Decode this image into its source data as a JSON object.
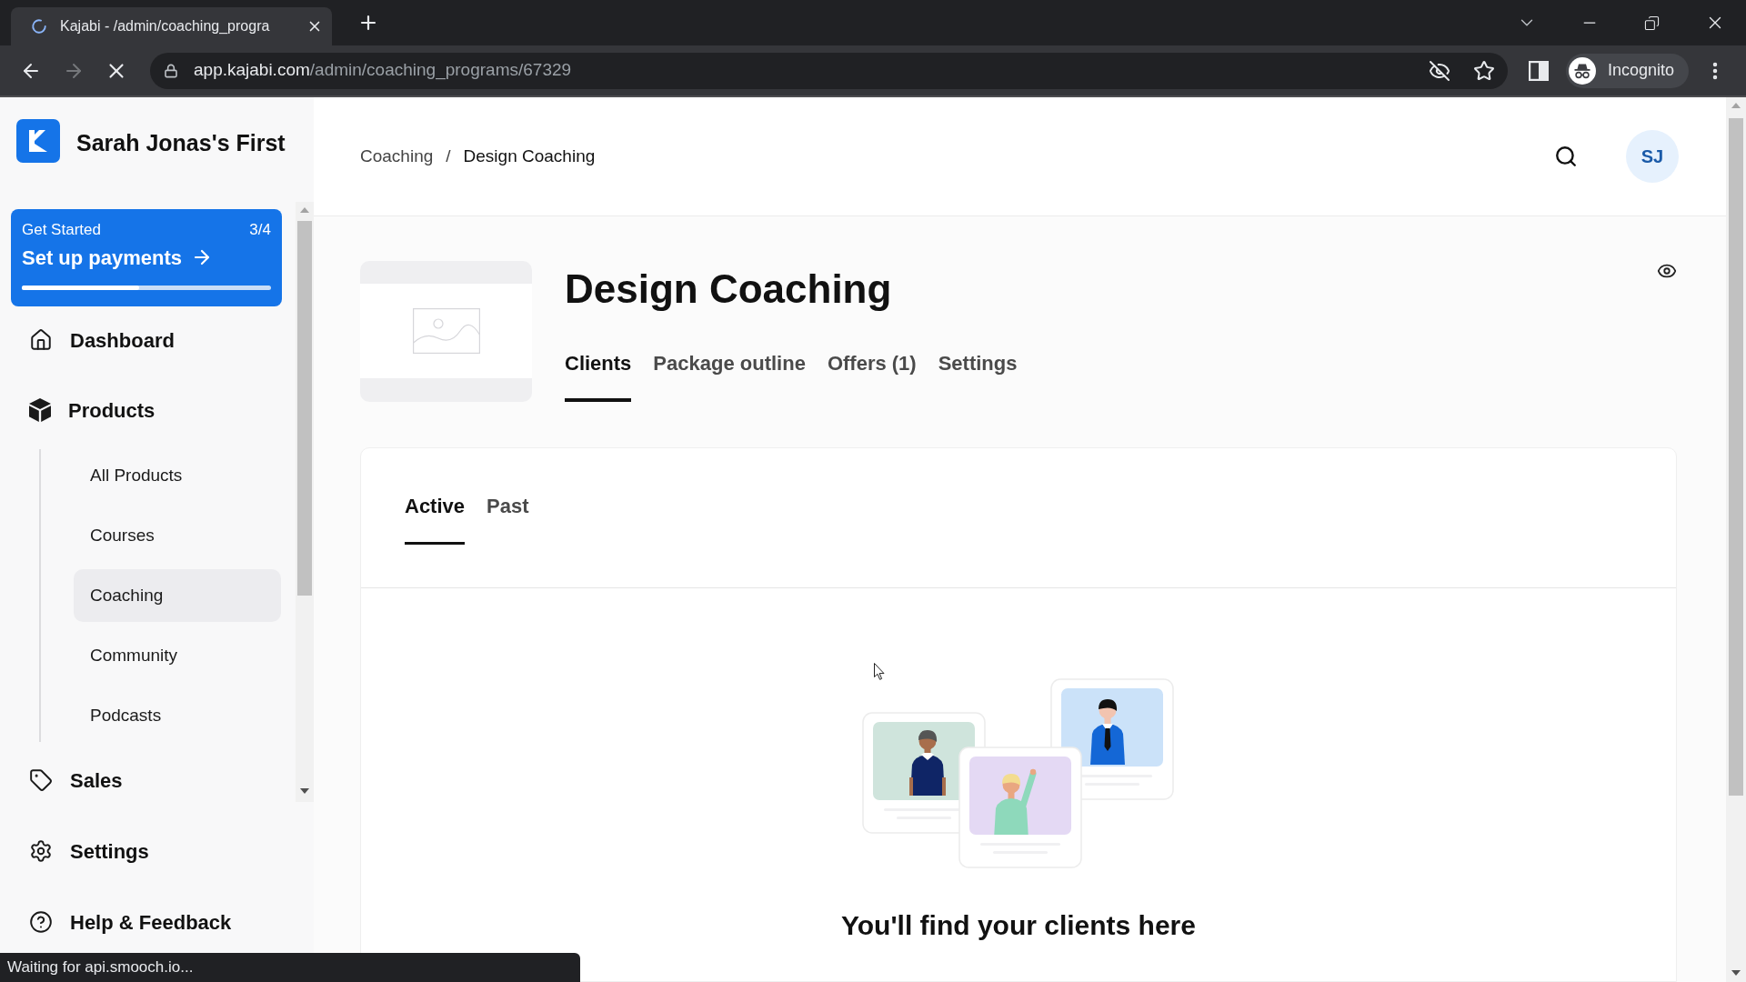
{
  "browser": {
    "loading": true,
    "forward_disabled": true,
    "tabs": [
      {
        "title": "Kajabi - /admin/coaching_progra",
        "selected": true
      }
    ],
    "url_host": "app.kajabi.com",
    "url_path": "/admin/coaching_programs/67329",
    "profile": "Incognito",
    "status": "Waiting for api.smooch.io..."
  },
  "sidebar": {
    "site_name": "Sarah Jonas's First",
    "onboarding": {
      "label": "Get Started",
      "count": "3/4",
      "action": "Set up payments",
      "level": 0.47
    },
    "nav": [
      {
        "label": "Dashboard",
        "selected": false
      },
      {
        "label": "Products",
        "selected": false,
        "children": [
          {
            "label": "All Products",
            "selected": false
          },
          {
            "label": "Courses",
            "selected": false
          },
          {
            "label": "Coaching",
            "selected": true
          },
          {
            "label": "Community",
            "selected": false
          },
          {
            "label": "Podcasts",
            "selected": false
          }
        ]
      },
      {
        "label": "Sales",
        "selected": false
      }
    ],
    "footer_nav": [
      {
        "label": "Settings",
        "selected": false
      },
      {
        "label": "Help & Feedback",
        "selected": false
      }
    ]
  },
  "header": {
    "breadcrumb": [
      "Coaching",
      "Design Coaching"
    ],
    "breadcrumb_separator": "/",
    "avatar_initials": "SJ"
  },
  "program": {
    "title": "Design Coaching",
    "tabs": [
      {
        "label": "Clients",
        "selected": true
      },
      {
        "label": "Package outline",
        "selected": false
      },
      {
        "label": "Offers (1)",
        "selected": false
      },
      {
        "label": "Settings",
        "selected": false
      }
    ],
    "client_tabs": [
      {
        "label": "Active",
        "selected": true
      },
      {
        "label": "Past",
        "selected": false
      }
    ],
    "empty_state": {
      "heading": "You'll find your clients here"
    }
  }
}
